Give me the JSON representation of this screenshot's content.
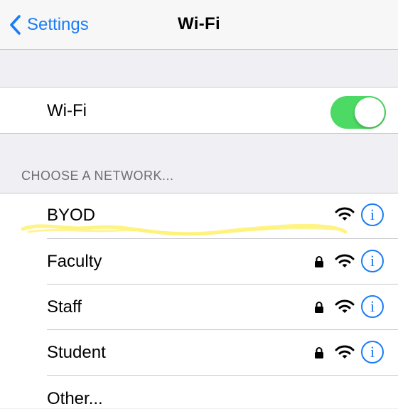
{
  "nav": {
    "back_label": "Settings",
    "title": "Wi-Fi"
  },
  "wifi_toggle": {
    "label": "Wi-Fi",
    "on": true,
    "color": "#4cd964"
  },
  "networks_header": "CHOOSE A NETWORK...",
  "networks": [
    {
      "name": "BYOD",
      "secured": false,
      "icon": "wifi-icon",
      "info": "i"
    },
    {
      "name": "Faculty",
      "secured": true,
      "icon": "wifi-icon",
      "info": "i"
    },
    {
      "name": "Staff",
      "secured": true,
      "icon": "wifi-icon",
      "info": "i"
    },
    {
      "name": "Student",
      "secured": true,
      "icon": "wifi-icon",
      "info": "i"
    }
  ],
  "other_label": "Other...",
  "colors": {
    "accent": "#1a7cf6",
    "background": "#efeff4",
    "highlight": "#fff275"
  }
}
